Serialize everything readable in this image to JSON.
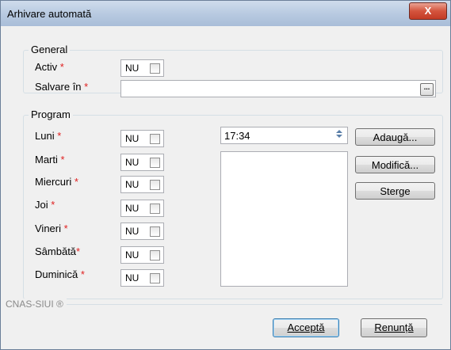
{
  "window": {
    "title": "Arhivare automată",
    "close_label": "X"
  },
  "general": {
    "legend": "General",
    "activ_label": "Activ",
    "activ_value": "NU",
    "salvare_label": "Salvare în",
    "salvare_value": "",
    "browse_label": "...",
    "required_marker": "*"
  },
  "program": {
    "legend": "Program",
    "days": [
      {
        "label": "Luni",
        "value": "NU"
      },
      {
        "label": "Marti",
        "value": "NU"
      },
      {
        "label": "Miercuri",
        "value": "NU"
      },
      {
        "label": "Joi",
        "value": "NU"
      },
      {
        "label": "Vineri",
        "value": "NU"
      },
      {
        "label": "Sâmbătă",
        "value": "NU"
      },
      {
        "label": "Duminică",
        "value": "NU"
      }
    ],
    "time_value": "17:34",
    "schedule_entries": [],
    "buttons": {
      "add": "Adaugă...",
      "modify": "Modifică...",
      "delete": "Sterge"
    }
  },
  "footer": {
    "brand": "CNAS-SIUI ®",
    "accept": "Acceptă",
    "cancel": "Renunță"
  }
}
